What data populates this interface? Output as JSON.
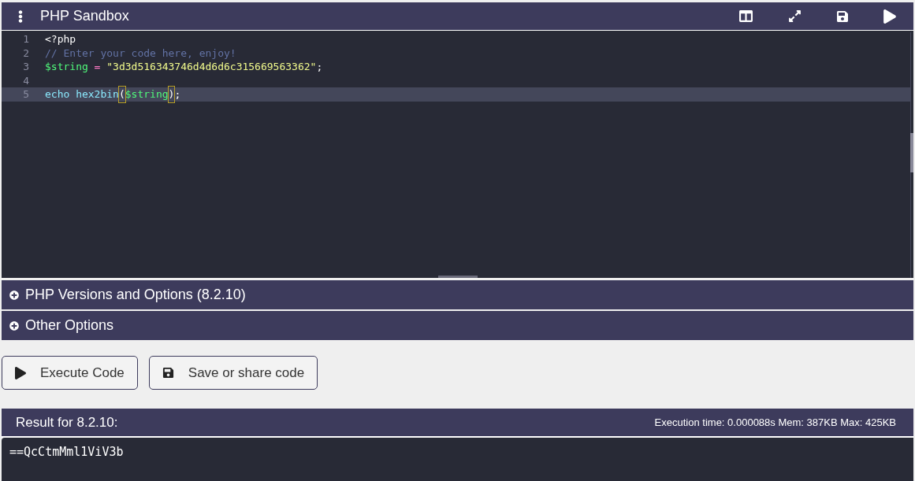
{
  "header": {
    "title": "PHP Sandbox"
  },
  "editor": {
    "lines": [
      {
        "number": "1",
        "active": false,
        "tokens": [
          {
            "kind": "tag",
            "text": "<?php"
          }
        ]
      },
      {
        "number": "2",
        "active": false,
        "tokens": [
          {
            "kind": "comment",
            "text": "// Enter your code here, enjoy!"
          }
        ]
      },
      {
        "number": "3",
        "active": false,
        "tokens": [
          {
            "kind": "variable",
            "text": "$string"
          },
          {
            "kind": "operator",
            "text": " = "
          },
          {
            "kind": "string",
            "text": "\"3d3d516343746d4d6d6c315669563362\""
          },
          {
            "kind": "plain",
            "text": ";"
          }
        ]
      },
      {
        "number": "4",
        "active": false
      },
      {
        "number": "5",
        "active": true,
        "tokens": [
          {
            "kind": "function",
            "text": "echo hex2bin"
          },
          {
            "kind": "bracket",
            "text": "("
          },
          {
            "kind": "variable",
            "text": "$string"
          },
          {
            "kind": "bracket",
            "text": ")"
          },
          {
            "kind": "plain",
            "text": ";"
          }
        ]
      }
    ]
  },
  "sections": [
    {
      "label": "PHP Versions and Options (8.2.10)",
      "expanded": false
    },
    {
      "label": "Other Options",
      "expanded": false
    }
  ],
  "buttons": [
    {
      "kind": "run",
      "label": "Execute Code"
    },
    {
      "kind": "save",
      "label": "Save or share code"
    }
  ],
  "result": {
    "title": "Result for 8.2.10:",
    "stats": "Execution time: 0.000088s Mem: 387KB Max: 425KB",
    "output": "==QcCtmMml1ViV3b"
  }
}
